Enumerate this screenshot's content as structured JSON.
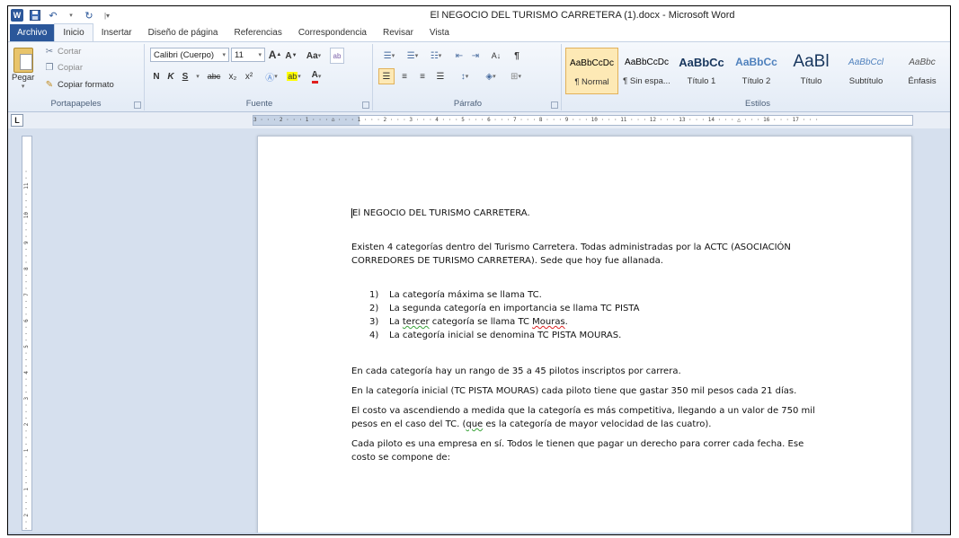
{
  "window": {
    "title": "El NEGOCIO DEL TURISMO CARRETERA (1).docx  -  Microsoft Word",
    "qat": {
      "logo": "W",
      "save_icon": "save-icon",
      "undo_icon": "undo-icon",
      "redo_icon": "redo-icon"
    }
  },
  "tabs": [
    {
      "label": "Archivo"
    },
    {
      "label": "Inicio"
    },
    {
      "label": "Insertar"
    },
    {
      "label": "Diseño de página"
    },
    {
      "label": "Referencias"
    },
    {
      "label": "Correspondencia"
    },
    {
      "label": "Revisar"
    },
    {
      "label": "Vista"
    }
  ],
  "ribbon": {
    "clipboard": {
      "label": "Portapapeles",
      "paste": "Pegar",
      "cut": "Cortar",
      "copy": "Copiar",
      "format_painter": "Copiar formato"
    },
    "font": {
      "label": "Fuente",
      "font_name": "Calibri (Cuerpo)",
      "font_size": "11",
      "grow": "A",
      "shrink": "A",
      "case": "Aa",
      "bold": "N",
      "italic": "K",
      "underline": "S",
      "strike": "abc",
      "subscript": "x₂",
      "superscript": "x²"
    },
    "paragraph": {
      "label": "Párrafo",
      "pilcrow": "¶",
      "sort": "A↓"
    },
    "styles": {
      "label": "Estilos",
      "items": [
        {
          "sample": "AaBbCcDc",
          "name": "¶ Normal",
          "selected": true
        },
        {
          "sample": "AaBbCcDc",
          "name": "¶ Sin espa..."
        },
        {
          "sample": "AaBbCc",
          "name": "Título 1"
        },
        {
          "sample": "AaBbCc",
          "name": "Título 2"
        },
        {
          "sample": "AaBl",
          "name": "Título"
        },
        {
          "sample": "AaBbCcl",
          "name": "Subtítulo"
        },
        {
          "sample": "AaBbc",
          "name": "Énfasis"
        }
      ]
    }
  },
  "ruler": {
    "tab_selector": "L",
    "horizontal": "3 · · · 2 · · · 1 · · · ⌂ · · · 1 · · · 2 · · · 3 · · · 4 · · · 5 · · · 6 · · · 7 · · · 8 · · · 9 · · · 10 · · · 11 · · · 12 · · · 13 · · · 14 · · · △ · · · 16 · · · 17 · · · ",
    "vertical": "· · 2 · · · 1 · · · · · 1 · · · 2 · · · 3 · · · 4 · · · 5 · · · 6 · · · 7 · · · 8 · · · 9 · · · 10 · · · 11 · ·"
  },
  "document": {
    "heading": "El NEGOCIO DEL TURISMO CARRETERA.",
    "intro": "Existen 4 categorías dentro del Turismo Carretera. Todas administradas por la ACTC (ASOCIACIÓN CORREDORES DE TURISMO CARRETERA). Sede que hoy fue allanada.",
    "list": [
      {
        "num": "1)",
        "pre": "La categoría máxima se llama TC.",
        "mark": "",
        "mid": "",
        "mark2": "",
        "post": ""
      },
      {
        "num": "2)",
        "pre": "La segunda categoría en importancia se llama TC PISTA",
        "mark": "",
        "mid": "",
        "mark2": "",
        "post": ""
      },
      {
        "num": "3)",
        "pre": "La ",
        "mark": "tercer",
        "mid": " categoría se llama TC ",
        "mark2": "Mouras",
        "post": "."
      },
      {
        "num": "4)",
        "pre": "La categoría inicial se denomina TC PISTA MOURAS.",
        "mark": "",
        "mid": "",
        "mark2": "",
        "post": ""
      }
    ],
    "p1": "En cada categoría hay un rango de 35 a 45 pilotos inscriptos por carrera.",
    "p2": "En la categoría inicial (TC PISTA MOURAS) cada piloto tiene que gastar 350 mil pesos cada 21 días.",
    "p3_pre": "El costo va ascendiendo a medida que la categoría es más competitiva, llegando a un valor de 750 mil pesos en el caso del TC. (",
    "p3_mark": "que",
    "p3_post": " es la categoría de mayor velocidad de las cuatro).",
    "p4": "Cada piloto es una empresa en sí. Todos le tienen que pagar un derecho para correr cada fecha. Ese costo se compone de:"
  }
}
